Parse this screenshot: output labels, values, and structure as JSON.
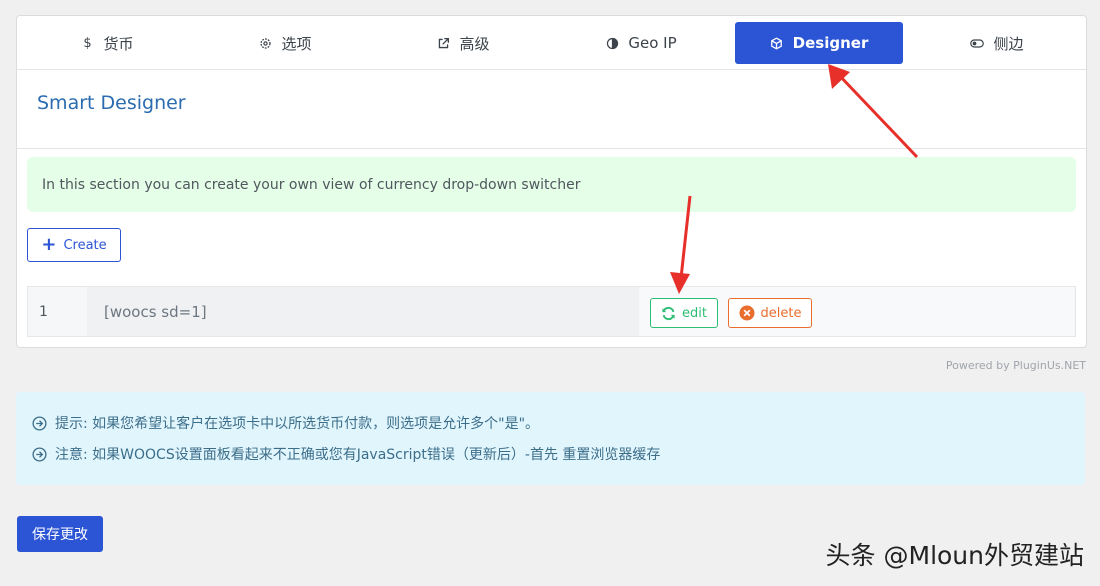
{
  "tabs": [
    {
      "label": "货币",
      "icon": "dollar-icon"
    },
    {
      "label": "选项",
      "icon": "gear-icon"
    },
    {
      "label": "高级",
      "icon": "external-link-icon"
    },
    {
      "label": "Geo IP",
      "icon": "globe-icon"
    },
    {
      "label": "Designer",
      "icon": "cube-icon",
      "active": true
    },
    {
      "label": "侧边",
      "icon": "toggle-icon"
    }
  ],
  "section": {
    "title": "Smart Designer",
    "notice": "In this section you can create your own view of currency drop-down switcher",
    "create_label": "Create"
  },
  "rows": [
    {
      "num": "1",
      "shortcode": "[woocs sd=1]",
      "edit_label": "edit",
      "delete_label": "delete"
    }
  ],
  "powered_by": "Powered by PluginUs.NET",
  "info": [
    "提示: 如果您希望让客户在选项卡中以所选货币付款，则选项是允许多个\"是\"。",
    "注意: 如果WOOCS设置面板看起来不正确或您有JavaScript错误（更新后）-首先 重置浏览器缓存"
  ],
  "save_label": "保存更改",
  "watermark": "头条 @Mloun外贸建站",
  "colors": {
    "accent": "#2c55d6",
    "title": "#2b6cb0",
    "edit": "#2ebd74",
    "delete": "#e96d2c",
    "notice_bg": "#e5fee8",
    "info_bg": "#e1f5fd",
    "annotation": "#e8302a"
  }
}
